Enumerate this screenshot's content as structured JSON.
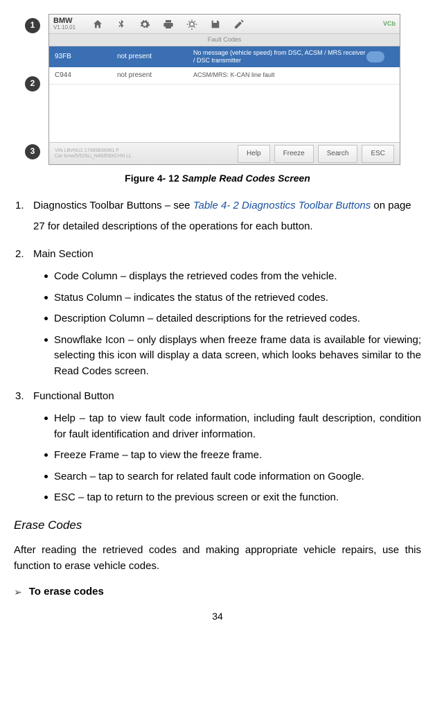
{
  "figure": {
    "badges": [
      "1",
      "2",
      "3"
    ],
    "brand_name": "BMW",
    "brand_version": "V1.10.01",
    "icons": [
      "home",
      "bluetooth",
      "gear",
      "print",
      "brightness",
      "save",
      "pencil"
    ],
    "right_status": "VCb",
    "breadcrumb_label": "Fault Codes",
    "rows": [
      {
        "code": "93FB",
        "status": "not present",
        "desc": "No message (vehicle speed) from DSC, ACSM / MRS receiver / DSC transmitter",
        "snow": true,
        "selected": true
      },
      {
        "code": "C944",
        "status": "not present",
        "desc": "ACSM/MRS: K-CAN line fault",
        "snow": false,
        "selected": false
      }
    ],
    "vin_line1": "VIN LBVNU1 17085B36961 F",
    "vin_line2": "Car bmw/5/528Li_N46/E60/CHN LL",
    "buttons": [
      "Help",
      "Freeze",
      "Search",
      "ESC"
    ],
    "caption_prefix": "Figure 4- 12",
    "caption_title": "Sample Read Codes Screen"
  },
  "list1": {
    "item1_a": "Diagnostics Toolbar Buttons – see ",
    "item1_link": "Table 4- 2 Diagnostics Toolbar Buttons",
    "item1_b": " on page 27 for detailed descriptions of the operations for each button.",
    "item2": "Main Section",
    "bullets2": [
      "Code Column – displays the retrieved codes from the vehicle.",
      "Status Column – indicates the status of the retrieved codes.",
      "Description Column – detailed descriptions for the retrieved codes.",
      "Snowflake Icon – only displays when freeze frame data is available for viewing; selecting this icon will display a data screen, which looks behaves similar to the Read Codes screen."
    ],
    "item3": "Functional Button",
    "bullets3": [
      "Help – tap to view fault code information, including fault description, condition for fault identification and driver information.",
      "Freeze Frame – tap to view the freeze frame.",
      "Search – tap to search for related fault code information on Google.",
      "ESC – tap to return to the previous screen or exit the function."
    ]
  },
  "erase": {
    "heading": "Erase Codes",
    "para": "After reading the retrieved codes and making appropriate vehicle repairs, use this function to erase vehicle codes.",
    "task": "To erase codes"
  },
  "page_number": "34"
}
